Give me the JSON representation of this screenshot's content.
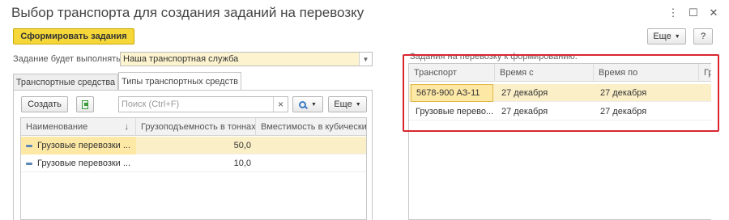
{
  "window": {
    "title": "Выбор транспорта для создания заданий на перевозку",
    "controls": {
      "more": "⋮",
      "maximize": "☐",
      "close": "✕"
    }
  },
  "toolbar": {
    "generate_label": "Сформировать задания",
    "more_label": "Еще",
    "help_label": "?"
  },
  "executor": {
    "label": "Задание будет выполнять:",
    "value": "Наша транспортная служба"
  },
  "tabs": [
    {
      "label": "Транспортные средства",
      "active": false
    },
    {
      "label": "Типы транспортных средств",
      "active": true
    }
  ],
  "left_toolbar": {
    "create_label": "Создать",
    "search_placeholder": "Поиск (Ctrl+F)",
    "clear_icon": "×",
    "more_label": "Еще"
  },
  "left_table": {
    "columns": [
      "Наименование",
      "Грузоподъемность в тоннах",
      "Вместимость в кубических"
    ],
    "sort_indicator": "↓",
    "rows": [
      {
        "name": "Грузовые перевозки ...",
        "capacity": "50,0",
        "volume": "",
        "selected": true
      },
      {
        "name": "Грузовые перевозки ...",
        "capacity": "10,0",
        "volume": "",
        "selected": false
      }
    ]
  },
  "right_panel": {
    "label": "Задания на перевозку к формированию:",
    "columns": [
      "Транспорт",
      "Время с",
      "Время по",
      "Гру"
    ],
    "rows": [
      {
        "transport": "5678-900 АЗ-11",
        "from": "27 декабря",
        "to": "27 декабря",
        "selected": true
      },
      {
        "transport": "Грузовые перево...",
        "from": "27 декабря",
        "to": "27 декабря",
        "selected": false
      }
    ]
  },
  "colors": {
    "accent_button": "#f5d73a",
    "selection": "#fbefc7",
    "highlight_frame": "#d8262f"
  }
}
